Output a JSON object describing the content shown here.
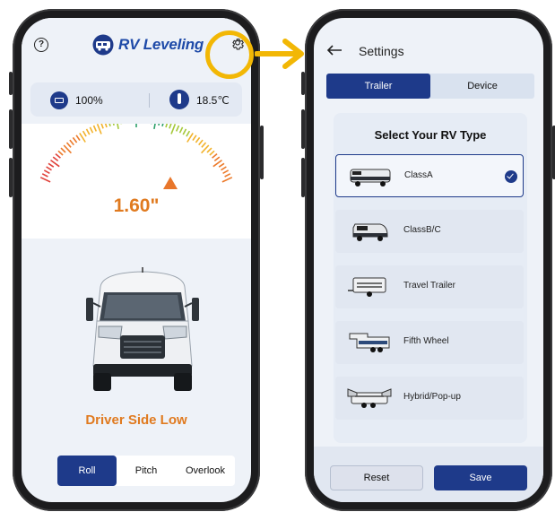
{
  "left_screen": {
    "header": {
      "help_icon": "question-circle-icon",
      "app_title": "RV Leveling",
      "settings_icon": "gear-icon"
    },
    "status": {
      "battery": "100%",
      "temperature": "18.5℃"
    },
    "gauge": {
      "value": "1.60\"",
      "pointer_color": "#e8762b"
    },
    "status_message": "Driver Side Low",
    "segments": {
      "roll": "Roll",
      "pitch": "Pitch",
      "overlook": "Overlook",
      "active": "Roll"
    }
  },
  "right_screen": {
    "header": {
      "back_icon": "arrow-left-icon",
      "title": "Settings"
    },
    "tabs": [
      {
        "label": "Trailer",
        "active": true
      },
      {
        "label": "Device",
        "active": false
      }
    ],
    "section_title": "Select Your RV Type",
    "rv_types": [
      {
        "label": "ClassA",
        "selected": true
      },
      {
        "label": "ClassB/C",
        "selected": false
      },
      {
        "label": "Travel Trailer",
        "selected": false
      },
      {
        "label": "Fifth Wheel",
        "selected": false
      },
      {
        "label": "Hybrid/Pop-up",
        "selected": false
      }
    ],
    "buttons": {
      "reset": "Reset",
      "save": "Save"
    }
  },
  "colors": {
    "primary": "#1e3a8a",
    "accent_orange": "#e07a1f",
    "highlight": "#f2b705"
  }
}
